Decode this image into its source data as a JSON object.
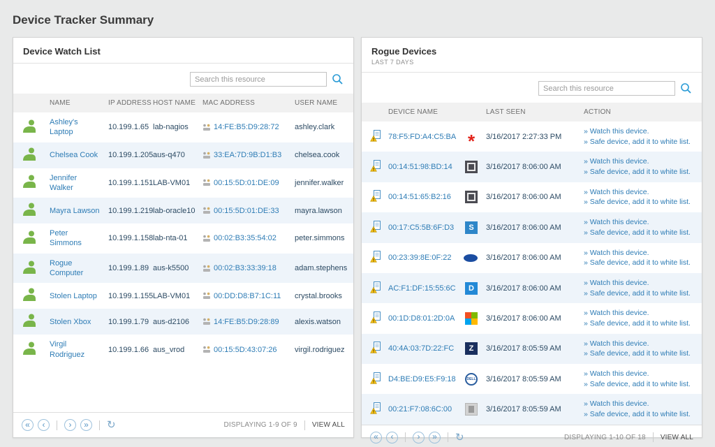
{
  "page_title": "Device Tracker Summary",
  "watch_list": {
    "title": "Device Watch List",
    "search_placeholder": "Search this resource",
    "columns": [
      "NAME",
      "IP ADDRESS",
      "HOST NAME",
      "MAC ADDRESS",
      "USER NAME"
    ],
    "rows": [
      {
        "name": "Ashley's Laptop",
        "ip": "10.199.1.65",
        "host": "lab-nagios",
        "mac": "14:FE:B5:D9:28:72",
        "user": "ashley.clark"
      },
      {
        "name": "Chelsea Cook",
        "ip": "10.199.1.205",
        "host": "aus-q470",
        "mac": "33:EA:7D:9B:D1:B3",
        "user": "chelsea.cook"
      },
      {
        "name": "Jennifer Walker",
        "ip": "10.199.1.151",
        "host": "LAB-VM01",
        "mac": "00:15:5D:01:DE:09",
        "user": "jennifer.walker"
      },
      {
        "name": "Mayra Lawson",
        "ip": "10.199.1.219",
        "host": "lab-oracle10",
        "mac": "00:15:5D:01:DE:33",
        "user": "mayra.lawson"
      },
      {
        "name": "Peter Simmons",
        "ip": "10.199.1.158",
        "host": "lab-nta-01",
        "mac": "00:02:B3:35:54:02",
        "user": "peter.simmons"
      },
      {
        "name": "Rogue Computer",
        "ip": "10.199.1.89",
        "host": "aus-k5500",
        "mac": "00:02:B3:33:39:18",
        "user": "adam.stephens"
      },
      {
        "name": "Stolen Laptop",
        "ip": "10.199.1.155",
        "host": "LAB-VM01",
        "mac": "00:DD:D8:B7:1C:11",
        "user": "crystal.brooks"
      },
      {
        "name": "Stolen Xbox",
        "ip": "10.199.1.79",
        "host": "aus-d2106",
        "mac": "14:FE:B5:D9:28:89",
        "user": "alexis.watson"
      },
      {
        "name": "Virgil Rodriguez",
        "ip": "10.199.1.66",
        "host": "aus_vrod",
        "mac": "00:15:5D:43:07:26",
        "user": "virgil.rodriguez"
      }
    ],
    "pagination": {
      "displaying": "DISPLAYING 1-9 OF 9",
      "view_all": "VIEW ALL"
    }
  },
  "rogue_devices": {
    "title": "Rogue Devices",
    "subtitle": "LAST 7 DAYS",
    "search_placeholder": "Search this resource",
    "columns": [
      "DEVICE NAME",
      "LAST SEEN",
      "ACTION"
    ],
    "action_watch": "» Watch this device.",
    "action_safe": "» Safe device, add it to white list.",
    "rows": [
      {
        "device": "78:F5:FD:A4:C5:BA",
        "vendor_icon": "huawei",
        "last_seen": "3/16/2017 2:27:33 PM"
      },
      {
        "device": "00:14:51:98:BD:14",
        "vendor_icon": "dark",
        "last_seen": "3/16/2017 8:06:00 AM"
      },
      {
        "device": "00:14:51:65:B2:16",
        "vendor_icon": "dark",
        "last_seen": "3/16/2017 8:06:00 AM"
      },
      {
        "device": "00:17:C5:5B:6F:D3",
        "vendor_icon": "s",
        "last_seen": "3/16/2017 8:06:00 AM"
      },
      {
        "device": "00:23:39:8E:0F:22",
        "vendor_icon": "oval",
        "last_seen": "3/16/2017 8:06:00 AM"
      },
      {
        "device": "AC:F1:DF:15:55:6C",
        "vendor_icon": "d",
        "last_seen": "3/16/2017 8:06:00 AM"
      },
      {
        "device": "00:1D:D8:01:2D:0A",
        "vendor_icon": "microsoft",
        "last_seen": "3/16/2017 8:06:00 AM"
      },
      {
        "device": "40:4A:03:7D:22:FC",
        "vendor_icon": "z",
        "last_seen": "3/16/2017 8:05:59 AM"
      },
      {
        "device": "D4:BE:D9:E5:F9:18",
        "vendor_icon": "dell",
        "last_seen": "3/16/2017 8:05:59 AM"
      },
      {
        "device": "00:21:F7:08:6C:00",
        "vendor_icon": "gray",
        "last_seen": "3/16/2017 8:05:59 AM"
      }
    ],
    "pagination": {
      "displaying": "DISPLAYING 1-10 OF 18",
      "view_all": "VIEW ALL"
    }
  }
}
